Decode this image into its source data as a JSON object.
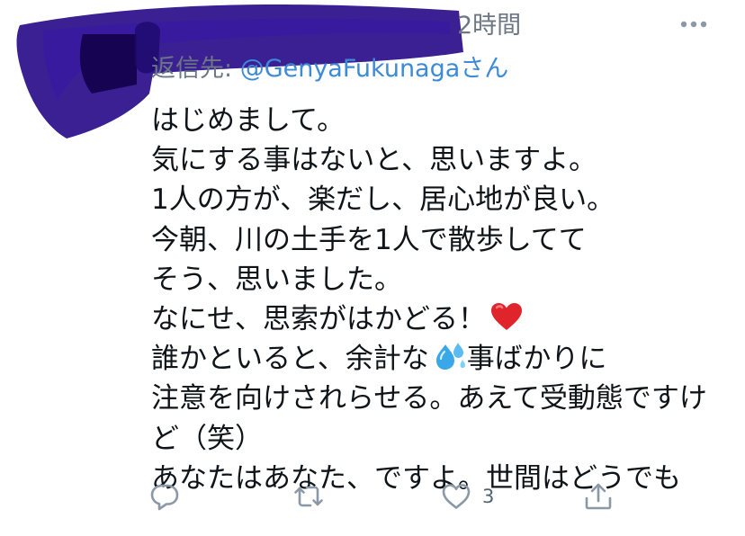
{
  "tweet": {
    "timestamp": "2時間",
    "reply_prefix": "返信先: ",
    "reply_handle": "@GenyaFukunaga",
    "reply_suffix": "さん",
    "lines": [
      "はじめまして。",
      "気にする事はないと、思いますよ。",
      "1人の方が、楽だし、居心地が良い。",
      "今朝、川の土手を1人で散歩してて",
      "そう、思いました。",
      "なにせ、思索がはかどる！",
      "誰かといると、余計な",
      "事ばかりに",
      "注意を向けされらせる。あえて受動態ですけ",
      "ど（笑）",
      "あなたはあなた、ですよ。世間はどうでも"
    ],
    "emojis": {
      "heart": "red-heart",
      "sweat": "sweat-droplets"
    },
    "colors": {
      "text": "#0f1419",
      "muted": "#6b7785",
      "link": "#3d8ad6",
      "icon": "#8b98a5",
      "redaction": "#2a0d8a",
      "heart_emoji": "#e0242c",
      "sweat_emoji": "#3aa7e8"
    }
  },
  "actions": {
    "reply_icon": "reply-bubble-icon",
    "retweet_icon": "retweet-arrows-icon",
    "like_icon": "heart-outline-icon",
    "like_count": "3",
    "share_icon": "share-upload-icon"
  },
  "menu": {
    "more_icon": "more-dots-icon"
  }
}
